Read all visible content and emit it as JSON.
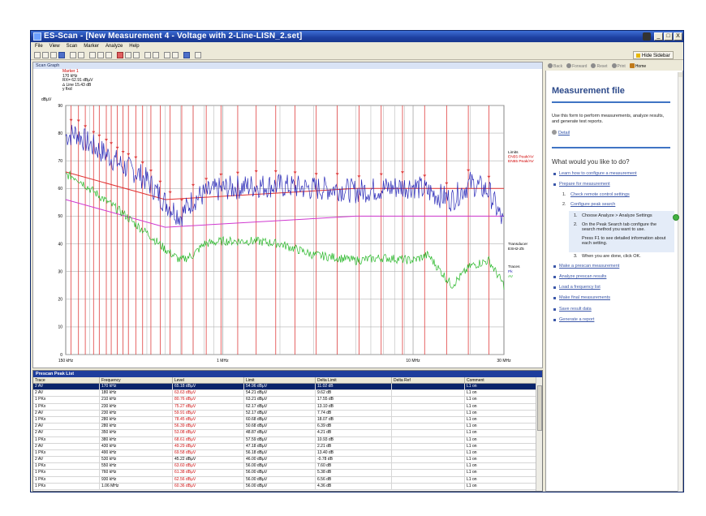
{
  "window": {
    "title": "ES-Scan - [New Measurement 4 - Voltage with 2-Line-LISN_2.set]",
    "controls": [
      "_",
      "□",
      "X"
    ]
  },
  "menu": [
    "File",
    "View",
    "Scan",
    "Marker",
    "Analyze",
    "Help"
  ],
  "toolbar": {
    "hide_sidebar_label": "Hide Sidebar"
  },
  "scan_graph": {
    "caption": "Scan Graph",
    "marker": {
      "title": "Marker 1",
      "freq": "170 kHz",
      "level": "RX=  62.91 dBµV",
      "delta": "∆ Line 15.43 dB",
      "mode": "y fixd"
    },
    "legend_right": [
      {
        "label": "Limits",
        "color": "#000000"
      },
      {
        "label": "EN55 Peak/AV",
        "color": "#d00000"
      },
      {
        "label": "EN55 Peak/AV",
        "color": "#d00000"
      }
    ],
    "transducer_label": [
      "Transducer",
      "ESH2-Z5"
    ],
    "traces_label": [
      "Traces",
      "Pk",
      "AV"
    ]
  },
  "chart_data": {
    "type": "line",
    "xscale": "log",
    "xlim": [
      150000,
      30000000
    ],
    "ylim": [
      0,
      90
    ],
    "ylabel": "dBµV",
    "yticks": [
      0,
      10,
      20,
      30,
      40,
      50,
      60,
      70,
      80,
      90
    ],
    "xtick_labels": [
      {
        "value": 150000,
        "label": "150 kHz"
      },
      {
        "value": 1000000,
        "label": "1 MHz"
      },
      {
        "value": 10000000,
        "label": "10 MHz"
      },
      {
        "value": 30000000,
        "label": "30 MHz"
      }
    ],
    "grid": true,
    "series": [
      {
        "name": "Pk",
        "color": "#2a2ab8",
        "x": [
          150000,
          170000,
          200000,
          250000,
          300000,
          350000,
          400000,
          500000,
          600000,
          700000,
          800000,
          1000000,
          1500000,
          2000000,
          3000000,
          4000000,
          5000000,
          7000000,
          10000000,
          13000000,
          16000000,
          20000000,
          25000000,
          30000000
        ],
        "y": [
          79,
          80,
          76,
          72,
          68,
          66,
          63,
          55,
          50,
          56,
          58,
          60,
          61,
          61,
          60,
          60,
          59,
          60,
          61,
          58,
          56,
          62,
          59,
          47
        ]
      },
      {
        "name": "AV",
        "color": "#2ab82a",
        "x": [
          150000,
          170000,
          200000,
          250000,
          300000,
          350000,
          400000,
          500000,
          600000,
          700000,
          800000,
          1000000,
          1500000,
          2000000,
          3000000,
          4000000,
          5000000,
          7000000,
          10000000,
          12000000,
          14000000,
          16000000,
          20000000,
          25000000,
          30000000
        ],
        "y": [
          65,
          64,
          60,
          55,
          51,
          47,
          44,
          38,
          34,
          36,
          40,
          41,
          41,
          40,
          36,
          35,
          34,
          35,
          34,
          36,
          30,
          25,
          32,
          34,
          25
        ]
      }
    ],
    "limits": [
      {
        "name": "EN55 Peak",
        "color": "#e03030",
        "x": [
          150000,
          500000,
          5000000,
          30000000
        ],
        "y": [
          66,
          56,
          60,
          60
        ]
      },
      {
        "name": "EN55 AV",
        "color": "#d038d0",
        "x": [
          150000,
          500000,
          5000000,
          30000000
        ],
        "y": [
          56,
          46,
          50,
          50
        ]
      }
    ],
    "peak_markers_x": [
      160000,
      175000,
      190000,
      210000,
      225000,
      245000,
      260000,
      280000,
      300000,
      320000,
      350000,
      380000,
      420000,
      470000,
      530000,
      610000,
      700000,
      820000,
      980000,
      1200000,
      1500000,
      1900000,
      2400000,
      3100000,
      4000000,
      5200000,
      6800000,
      8800000,
      11500000,
      15000000,
      19500000,
      25000000
    ]
  },
  "peak_list": {
    "caption": "Prescan Peak List",
    "columns": [
      "Trace",
      "Frequency",
      "Level",
      "Limit",
      "Delta Limit",
      "Delta Ref",
      "Comment"
    ],
    "rows": [
      [
        "2 AV",
        "170 kHz",
        "65.18 dBµV",
        "54.96 dBµV",
        "11.02 dB",
        "",
        "L1 on"
      ],
      [
        "2 AV",
        "180 kHz",
        "63.63 dBµV",
        "54.21 dBµV",
        "9.62 dB",
        "",
        "L1 on"
      ],
      [
        "1 PKx",
        "210 kHz",
        "80.76 dBµV",
        "63.21 dBµV",
        "17.55 dB",
        "",
        "L1 on"
      ],
      [
        "1 PKx",
        "230 kHz",
        "75.27 dBµV",
        "62.17 dBµV",
        "13.10 dB",
        "",
        "L1 on"
      ],
      [
        "2 AV",
        "230 kHz",
        "59.91 dBµV",
        "52.17 dBµV",
        "7.74 dB",
        "",
        "L1 on"
      ],
      [
        "1 PKx",
        "280 kHz",
        "78.45 dBµV",
        "60.68 dBµV",
        "18.07 dB",
        "",
        "L1 on"
      ],
      [
        "2 AV",
        "280 kHz",
        "56.39 dBµV",
        "50.68 dBµV",
        "6.39 dB",
        "",
        "L1 on"
      ],
      [
        "2 AV",
        "350 kHz",
        "53.08 dBµV",
        "48.87 dBµV",
        "4.21 dB",
        "",
        "L1 on"
      ],
      [
        "1 PKx",
        "380 kHz",
        "68.61 dBµV",
        "57.59 dBµV",
        "10.93 dB",
        "",
        "L1 on"
      ],
      [
        "2 AV",
        "430 kHz",
        "49.29 dBµV",
        "47.18 dBµV",
        "2.21 dB",
        "",
        "L1 on"
      ],
      [
        "1 PKx",
        "490 kHz",
        "69.58 dBµV",
        "56.18 dBµV",
        "13.40 dB",
        "",
        "L1 on"
      ],
      [
        "2 AV",
        "530 kHz",
        "45.22 dBµV",
        "46.00 dBµV",
        "-0.78 dB",
        "",
        "L1 on"
      ],
      [
        "1 PKx",
        "550 kHz",
        "63.60 dBµV",
        "56.00 dBµV",
        "7.60 dB",
        "",
        "L1 on"
      ],
      [
        "1 PKx",
        "760 kHz",
        "61.38 dBµV",
        "56.00 dBµV",
        "5.38 dB",
        "",
        "L1 on"
      ],
      [
        "1 PKx",
        "930 kHz",
        "62.56 dBµV",
        "56.00 dBµV",
        "6.56 dB",
        "",
        "L1 on"
      ],
      [
        "1 PKx",
        "1.06 MHz",
        "60.36 dBµV",
        "56.00 dBµV",
        "4.36 dB",
        "",
        "L1 on"
      ]
    ],
    "red_level_rows": [
      0,
      1,
      2,
      3,
      4,
      5,
      6,
      7,
      8,
      9,
      10,
      12,
      13,
      14,
      15
    ]
  },
  "sidebar": {
    "toolbar": [
      "Back",
      "Forward",
      "Reset",
      "Print",
      "Home"
    ],
    "title": "Measurement file",
    "intro": "Use this form to perform measurements, analyze results, and generate test reports.",
    "detail_link": "Detail",
    "question": "What would you like to do?",
    "items_top": [
      "Learn how to configure a measurement",
      "Prepare for measurement"
    ],
    "sub_items": [
      "Check remote control settings",
      "Configure peak search"
    ],
    "steps": [
      "Choose Analyze > Analyze Settings",
      "On the Peak Search tab configure the search method you want to use.",
      "Press F1 to see detailed information about each setting."
    ],
    "step_after": "When you are done, click OK.",
    "items_bottom": [
      "Make a prescan measurement",
      "Analyze prescan results",
      "Load a frequency list",
      "Make final measurements",
      "Save result data",
      "Generate a report"
    ]
  }
}
